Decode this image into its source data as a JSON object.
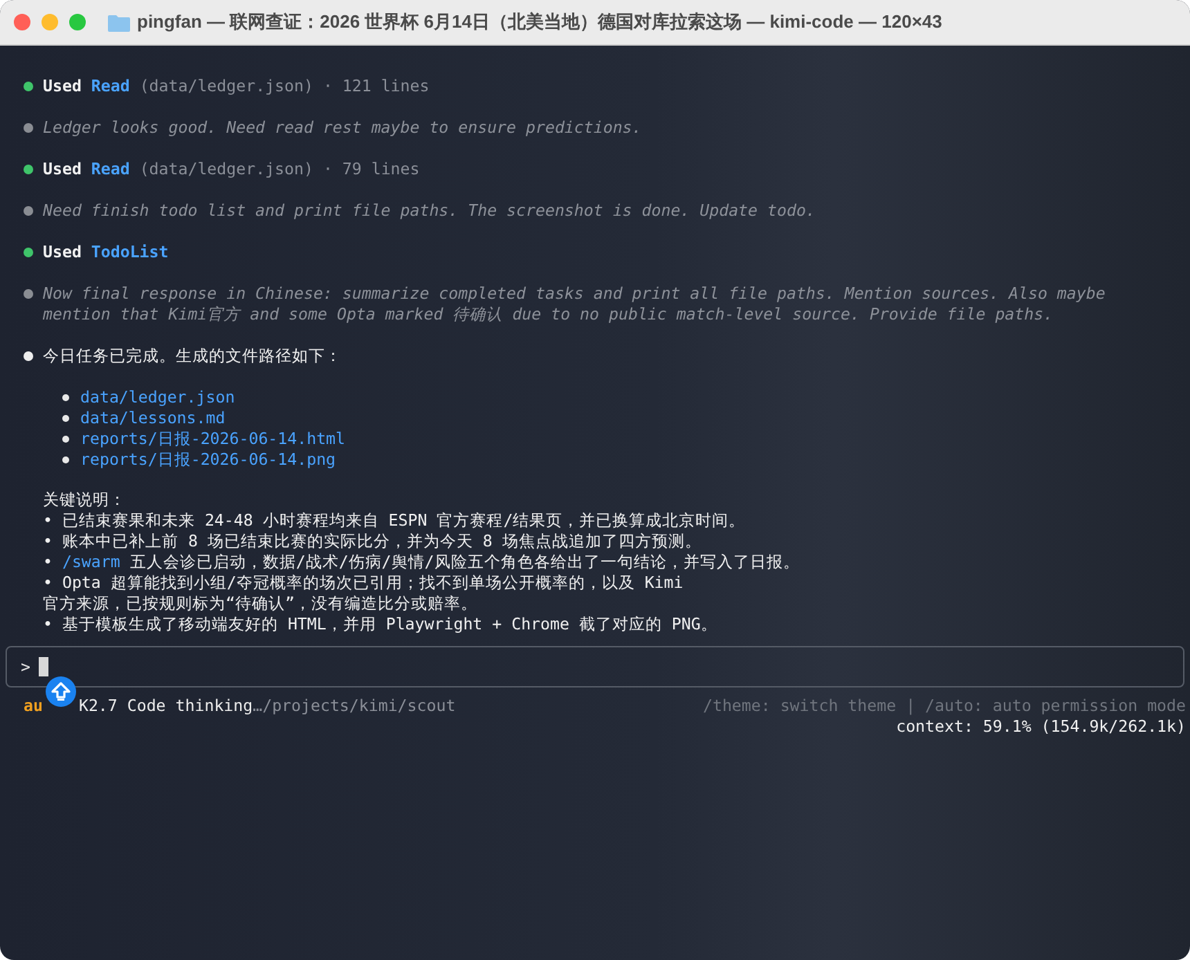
{
  "window": {
    "title": "pingfan — 联网查证：2026 世界杯 6月14日（北美当地）德国对库拉索这场 — kimi-code — 120×43"
  },
  "log": [
    {
      "kind": "tool",
      "verb": "Used",
      "tool": "Read",
      "args": "(data/ledger.json)",
      "detail": "· 121 lines"
    },
    {
      "kind": "thought",
      "lines": [
        "Ledger looks good. Need read rest maybe to ensure predictions."
      ]
    },
    {
      "kind": "tool",
      "verb": "Used",
      "tool": "Read",
      "args": "(data/ledger.json)",
      "detail": "· 79 lines"
    },
    {
      "kind": "thought",
      "lines": [
        "Need finish todo list and print file paths. The screenshot is done. Update todo."
      ]
    },
    {
      "kind": "tool",
      "verb": "Used",
      "tool": "TodoList"
    },
    {
      "kind": "thought",
      "lines": [
        "Now final response in Chinese: summarize completed tasks and print all file paths. Mention sources. Also maybe",
        "mention that Kimi官方 and some Opta marked 待确认 due to no public match-level source. Provide file paths."
      ]
    },
    {
      "kind": "message",
      "text": "今日任务已完成。生成的文件路径如下：",
      "files": [
        "data/ledger.json",
        "data/lessons.md",
        "reports/日报-2026-06-14.html",
        "reports/日报-2026-06-14.png"
      ],
      "notes_heading": "关键说明：",
      "notes": [
        {
          "bullet": "•",
          "text": "已结束赛果和未来 24-48 小时赛程均来自 ESPN 官方赛程/结果页，并已换算成北京时间。"
        },
        {
          "bullet": "•",
          "text": "账本中已补上前 8 场已结束比赛的实际比分，并为今天 8 场焦点战追加了四方预测。"
        },
        {
          "bullet": "•",
          "command": "/swarm",
          "text": "五人会诊已启动，数据/战术/伤病/舆情/风险五个角色各给出了一句结论，并写入了日报。"
        },
        {
          "bullet": "•",
          "text": "Opta 超算能找到小组/夺冠概率的场次已引用；找不到单场公开概率的，以及 Kimi",
          "continuation": "官方来源，已按规则标为“待确认”，没有编造比分或赔率。"
        },
        {
          "bullet": "•",
          "text": "基于模板生成了移动端友好的 HTML，并用 Playwright + Chrome 截了对应的 PNG。"
        }
      ]
    }
  ],
  "prompt": {
    "symbol": ">"
  },
  "status": {
    "mode": "au",
    "model": "K2.7 Code thinking",
    "path": "…/projects/kimi/scout",
    "hints": "/theme: switch theme | /auto: auto permission mode",
    "context": "context: 59.1% (154.9k/262.1k)"
  }
}
